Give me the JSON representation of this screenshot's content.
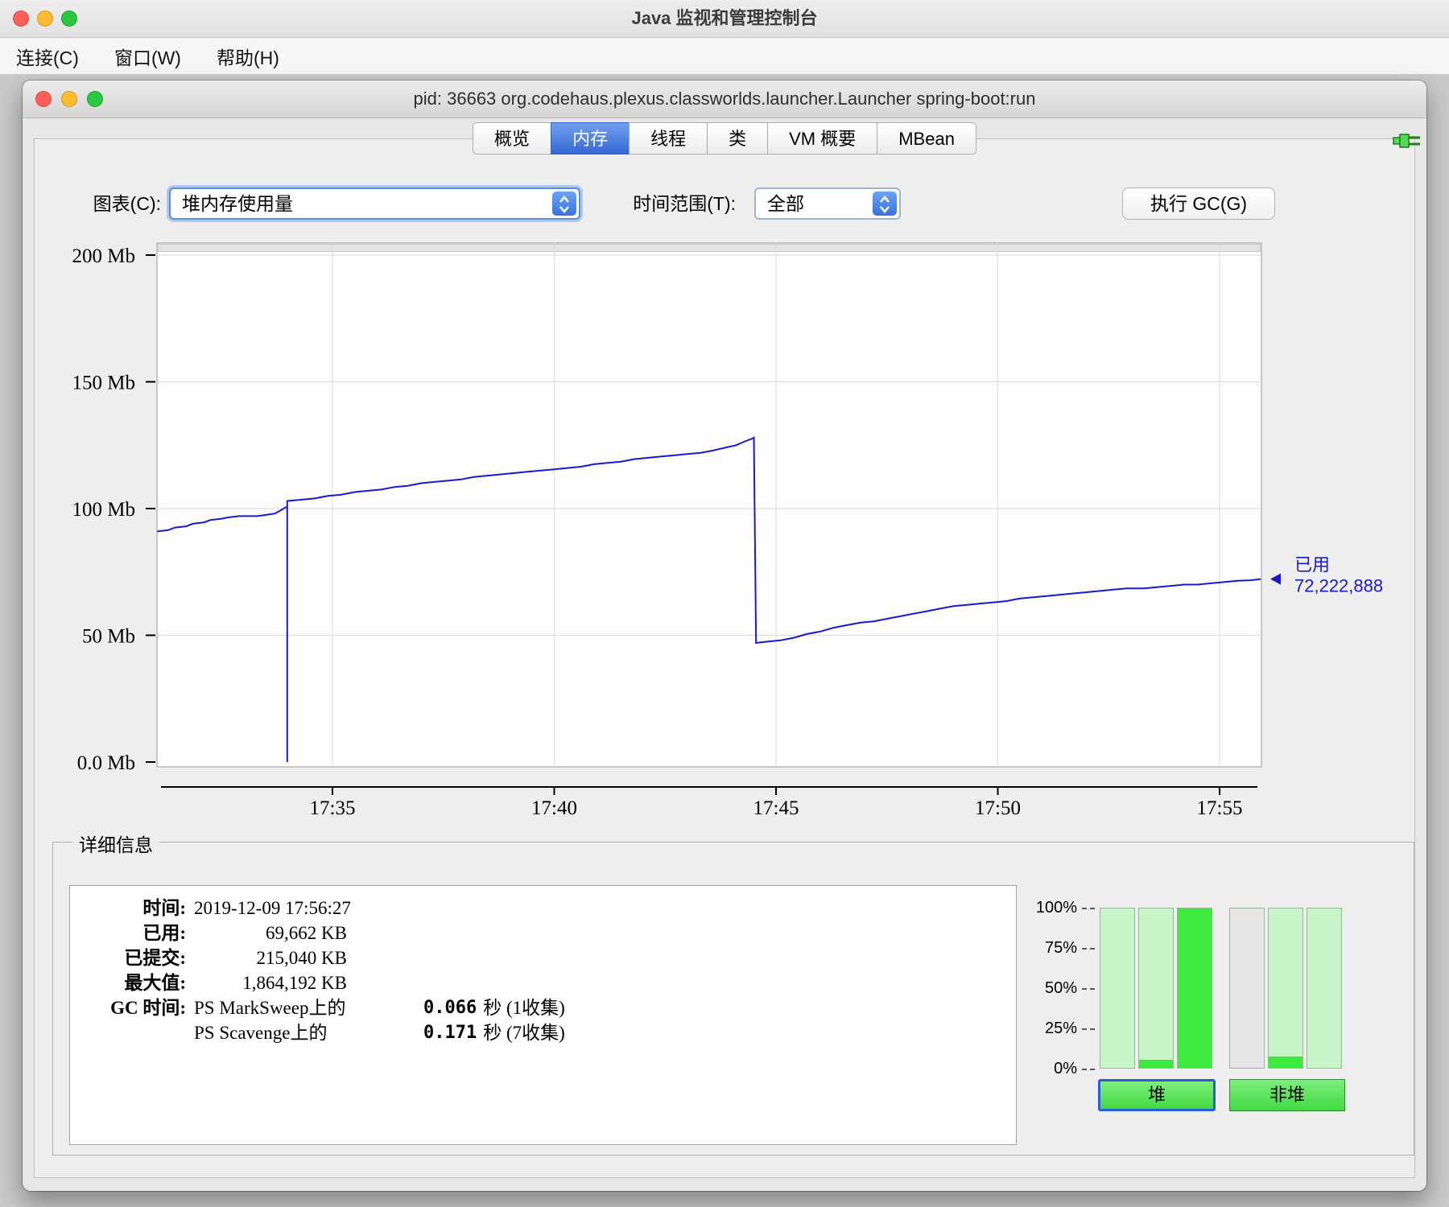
{
  "os_window": {
    "title": "Java 监视和管理控制台",
    "menu_items": [
      "连接(C)",
      "窗口(W)",
      "帮助(H)"
    ]
  },
  "app_window": {
    "title": "pid: 36663 org.codehaus.plexus.classworlds.launcher.Launcher spring-boot:run",
    "tabs": [
      {
        "label": "概览",
        "active": false
      },
      {
        "label": "内存",
        "active": true
      },
      {
        "label": "线程",
        "active": false
      },
      {
        "label": "类",
        "active": false
      },
      {
        "label": "VM 概要",
        "active": false
      },
      {
        "label": "MBean",
        "active": false
      }
    ]
  },
  "controls": {
    "chart_label": "图表(C):",
    "chart_value": "堆内存使用量",
    "range_label": "时间范围(T):",
    "range_value": "全部",
    "gc_button": "执行 GC(G)"
  },
  "chart_data": {
    "type": "line",
    "title": "堆内存使用量",
    "xlabel": "",
    "ylabel": "",
    "y_unit": "Mb",
    "ylim": [
      0,
      200
    ],
    "grid": true,
    "legend_position": "none",
    "line_color": "#1a1acd",
    "x_ticks": [
      {
        "t": 5,
        "label": "17:35"
      },
      {
        "t": 10,
        "label": "17:40"
      },
      {
        "t": 15,
        "label": "17:45"
      },
      {
        "t": 20,
        "label": "17:50"
      },
      {
        "t": 25,
        "label": "17:55"
      }
    ],
    "y_ticks": [
      {
        "v": 0,
        "label": "0.0 Mb"
      },
      {
        "v": 50,
        "label": "50 Mb"
      },
      {
        "v": 100,
        "label": "100 Mb"
      },
      {
        "v": 150,
        "label": "150 Mb"
      },
      {
        "v": 200,
        "label": "200 Mb"
      }
    ],
    "points_unit": "[minutes after 17:30, Mb used]",
    "points": [
      [
        1.05,
        91
      ],
      [
        1.3,
        91.5
      ],
      [
        1.45,
        92.5
      ],
      [
        1.7,
        93
      ],
      [
        1.85,
        94
      ],
      [
        2.1,
        94.5
      ],
      [
        2.25,
        95.5
      ],
      [
        2.5,
        96
      ],
      [
        2.65,
        96.5
      ],
      [
        2.9,
        97
      ],
      [
        3.3,
        97
      ],
      [
        3.5,
        97.5
      ],
      [
        3.7,
        98
      ],
      [
        3.85,
        99.5
      ],
      [
        3.95,
        100.5
      ],
      [
        3.98,
        100.5
      ],
      [
        3.98,
        0
      ],
      [
        3.98,
        103
      ],
      [
        4.3,
        103.5
      ],
      [
        4.6,
        104
      ],
      [
        4.9,
        105
      ],
      [
        5.2,
        105.5
      ],
      [
        5.5,
        106.5
      ],
      [
        5.8,
        107
      ],
      [
        6.1,
        107.5
      ],
      [
        6.4,
        108.5
      ],
      [
        6.7,
        109
      ],
      [
        7.0,
        110
      ],
      [
        7.3,
        110.5
      ],
      [
        7.6,
        111
      ],
      [
        7.9,
        111.5
      ],
      [
        8.2,
        112.5
      ],
      [
        8.5,
        113
      ],
      [
        8.8,
        113.5
      ],
      [
        9.1,
        114
      ],
      [
        9.4,
        114.5
      ],
      [
        9.7,
        115
      ],
      [
        10.0,
        115.5
      ],
      [
        10.3,
        116
      ],
      [
        10.6,
        116.5
      ],
      [
        10.9,
        117.5
      ],
      [
        11.2,
        118
      ],
      [
        11.5,
        118.5
      ],
      [
        11.8,
        119.5
      ],
      [
        12.1,
        120
      ],
      [
        12.4,
        120.5
      ],
      [
        12.7,
        121
      ],
      [
        13.0,
        121.5
      ],
      [
        13.3,
        122
      ],
      [
        13.6,
        123
      ],
      [
        13.85,
        124
      ],
      [
        14.1,
        125
      ],
      [
        14.3,
        126.5
      ],
      [
        14.45,
        127.5
      ],
      [
        14.5,
        128
      ],
      [
        14.55,
        47
      ],
      [
        14.8,
        47.5
      ],
      [
        15.1,
        48
      ],
      [
        15.4,
        49
      ],
      [
        15.7,
        50.5
      ],
      [
        16.0,
        51.5
      ],
      [
        16.3,
        53
      ],
      [
        16.6,
        54
      ],
      [
        16.9,
        55
      ],
      [
        17.2,
        55.5
      ],
      [
        17.5,
        56.5
      ],
      [
        17.8,
        57.5
      ],
      [
        18.1,
        58.5
      ],
      [
        18.4,
        59.5
      ],
      [
        18.7,
        60.5
      ],
      [
        19.0,
        61.5
      ],
      [
        19.3,
        62
      ],
      [
        19.6,
        62.5
      ],
      [
        19.9,
        63
      ],
      [
        20.2,
        63.5
      ],
      [
        20.5,
        64.5
      ],
      [
        20.8,
        65
      ],
      [
        21.1,
        65.5
      ],
      [
        21.4,
        66
      ],
      [
        21.7,
        66.5
      ],
      [
        22.0,
        67
      ],
      [
        22.3,
        67.5
      ],
      [
        22.6,
        68
      ],
      [
        22.9,
        68.5
      ],
      [
        23.3,
        68.5
      ],
      [
        23.6,
        69
      ],
      [
        23.9,
        69.5
      ],
      [
        24.2,
        70
      ],
      [
        24.5,
        70
      ],
      [
        24.8,
        70.5
      ],
      [
        25.1,
        71
      ],
      [
        25.4,
        71.5
      ],
      [
        25.7,
        71.7
      ],
      [
        25.93,
        72.2
      ]
    ],
    "annotation": {
      "label": "已用",
      "value": "72,222,888",
      "at_value": 72.2
    }
  },
  "details": {
    "legend": "详细信息",
    "rows": [
      {
        "label": "时间:",
        "value": "2019-12-09 17:56:27"
      },
      {
        "label": "已用:",
        "value": "69,662 KB"
      },
      {
        "label": "已提交:",
        "value": "215,040 KB"
      },
      {
        "label": "最大值:",
        "value": "1,864,192 KB"
      }
    ],
    "gc_rows": [
      {
        "label": "GC 时间:",
        "pool": "PS MarkSweep上的",
        "time": "0.066",
        "unit": "秒 (1收集)"
      },
      {
        "label": "",
        "pool": "PS Scavenge上的",
        "time": "0.171",
        "unit": "秒 (7收集)"
      }
    ]
  },
  "gauges": {
    "tick_labels": [
      "100%",
      "75%",
      "50%",
      "25%",
      "0%"
    ],
    "used_color": "#3dea3d",
    "groups": [
      {
        "id": "heap",
        "button_label": "堆",
        "selected": true,
        "bars": [
          {
            "base_color": "#c8f5c8",
            "used_pct": 0
          },
          {
            "base_color": "#c8f5c8",
            "used_pct": 5
          },
          {
            "base_color": "#3dea3d",
            "used_pct": 100
          }
        ]
      },
      {
        "id": "nonheap",
        "button_label": "非堆",
        "selected": false,
        "bars": [
          {
            "base_color": "#e6e6e6",
            "used_pct": 0
          },
          {
            "base_color": "#c8f5c8",
            "used_pct": 7
          },
          {
            "base_color": "#c8f5c8",
            "used_pct": 0
          }
        ]
      }
    ]
  }
}
